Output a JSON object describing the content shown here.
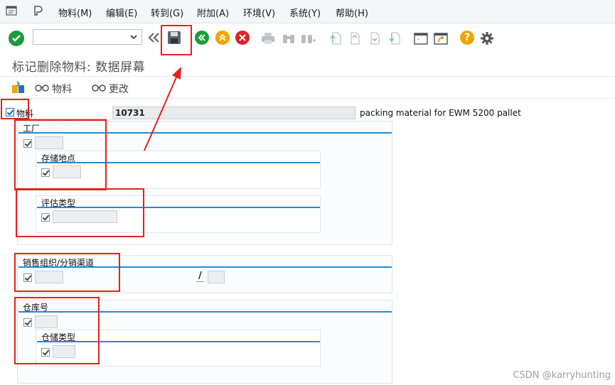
{
  "menu": {
    "items": [
      "物料(M)",
      "编辑(E)",
      "转到(G)",
      "附加(A)",
      "环境(V)",
      "系统(Y)",
      "帮助(H)"
    ]
  },
  "toolbar": {
    "command_field_value": "",
    "icons": [
      "check-icon",
      "dropdown-icon",
      "double-left-icon",
      "save-icon",
      "back-icon",
      "exit-icon",
      "cancel-icon",
      "print-icon",
      "find-icon",
      "find-next-icon",
      "first-page-icon",
      "prev-page-icon",
      "next-page-icon",
      "last-page-icon",
      "create-session-icon",
      "shortcut-icon",
      "help-icon",
      "settings-icon"
    ]
  },
  "title": "标记删除物料: 数据屏幕",
  "app_toolbar": {
    "material_label": "物料",
    "changes_label": "更改"
  },
  "material": {
    "label": "物料",
    "value": "10731",
    "description": "packing material for EWM 5200 pallet"
  },
  "plant_panel": {
    "title": "工厂"
  },
  "storage_location_panel": {
    "title": "存储地点"
  },
  "valuation_type_panel": {
    "title": "评估类型"
  },
  "sales_panel": {
    "title": "销售组织/分销渠道",
    "separator": "/"
  },
  "warehouse_panel": {
    "title": "仓库号"
  },
  "storage_type_panel": {
    "title": "仓储类型"
  },
  "watermark": "CSDN @karryhunting",
  "colors": {
    "accent_line": "#1f8fd6",
    "highlight": "#e2231a"
  }
}
